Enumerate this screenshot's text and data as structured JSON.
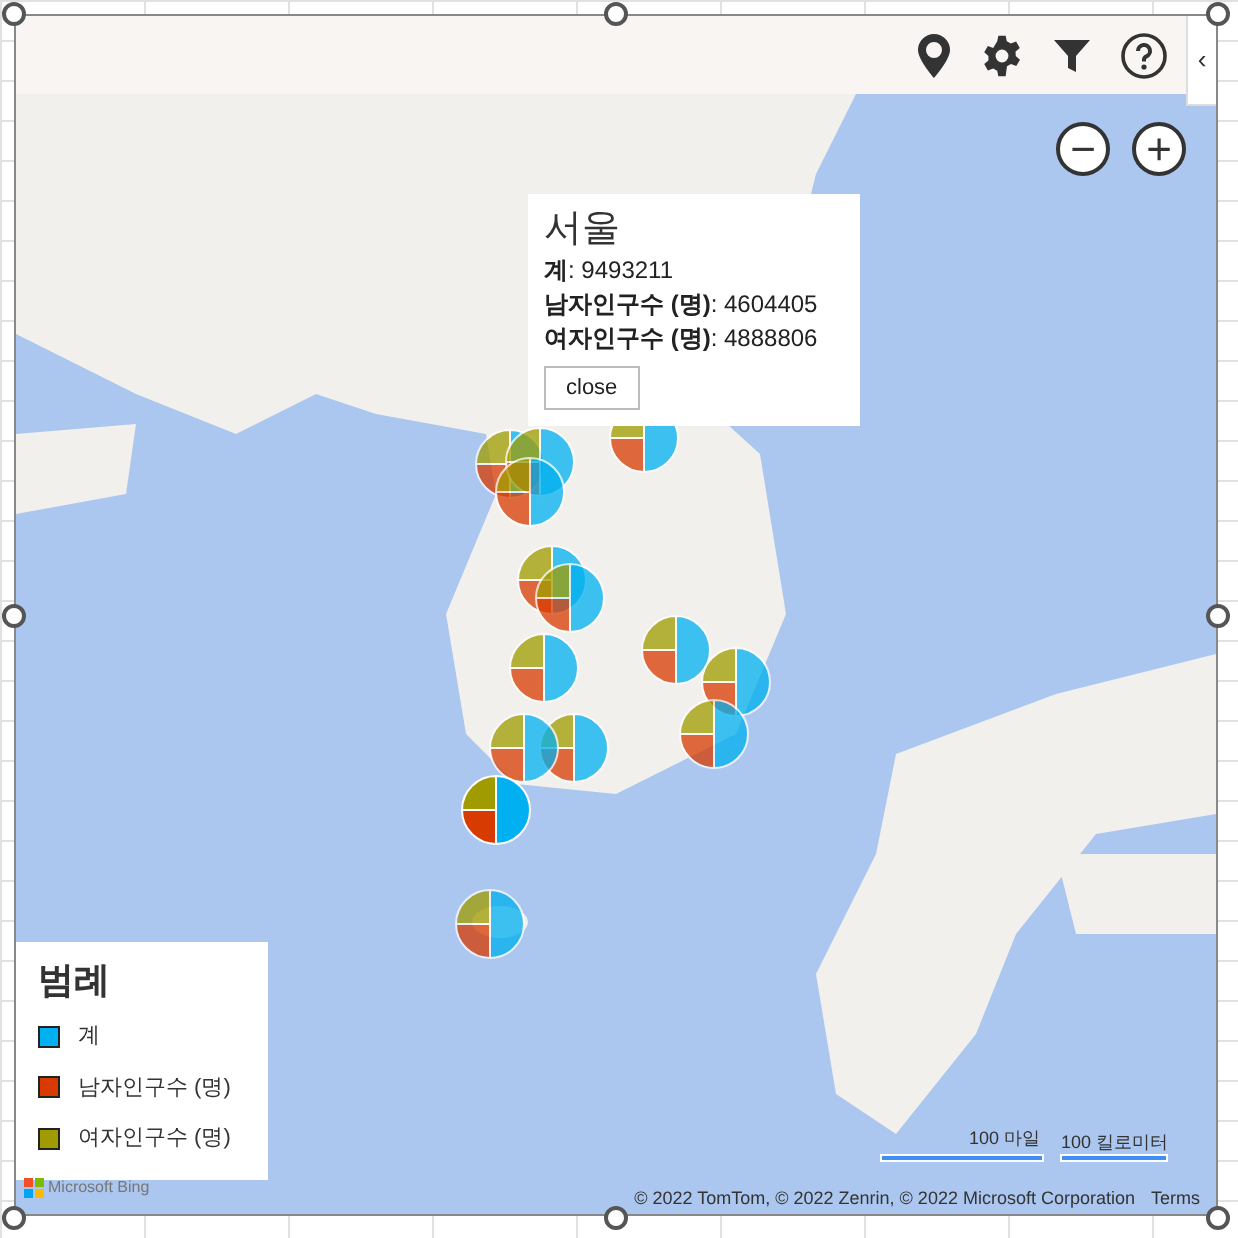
{
  "toolbar": {
    "collapse_label": "‹"
  },
  "map": {
    "zoom_out_label": "−",
    "zoom_in_label": "+"
  },
  "popup": {
    "title": "서울",
    "rows": [
      "**계**: 9493211",
      "**남자인구수 (명)**: 4604405",
      "**여자인구수 (명)**: 4888806"
    ],
    "close_label": "close"
  },
  "legend": {
    "title": "범례",
    "items": [
      {
        "label": "계",
        "color": "#00b0f0"
      },
      {
        "label": "남자인구수 (명)",
        "color": "#d83b01"
      },
      {
        "label": "여자인구수 (명)",
        "color": "#a09c00"
      }
    ]
  },
  "scale": {
    "miles": "100 마일",
    "km": "100 킬로미터"
  },
  "logo": "Microsoft Bing",
  "attribution": "© 2022 TomTom, © 2022 Zenrin, © 2022 Microsoft Corporation",
  "terms": "Terms"
}
